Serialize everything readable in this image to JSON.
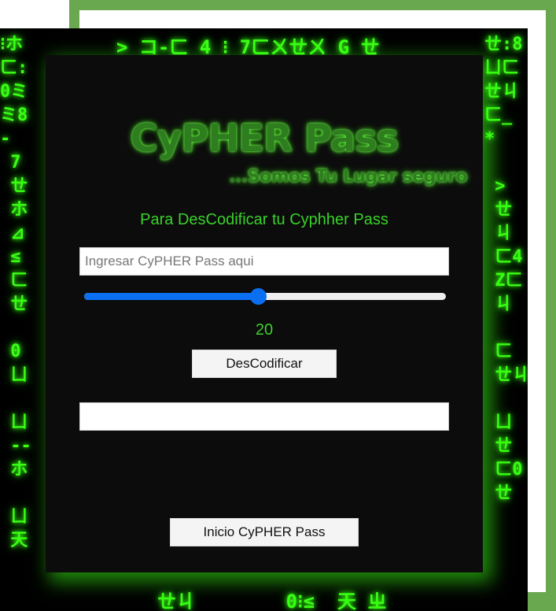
{
  "background": {
    "glyph_columns_left": [
      "⁝ホ",
      "ㄈ:",
      "0ミ",
      "ミ8",
      "-",
      " 7",
      " ㄝ",
      " ホ",
      " ⊿",
      " ≤",
      " ㄈ",
      " ㄝ",
      "",
      " 0",
      " ㄩ",
      "",
      " ㄩ",
      " --",
      " ホ",
      "",
      " ㄩ",
      " 天"
    ],
    "glyph_columns_right": [
      "ㄝ:8",
      "ㄩㄈ",
      "ㄝㄐ",
      "ㄈ_",
      "*",
      " ",
      " >",
      " ㄝ",
      " ㄐ",
      " ㄈ4",
      " Zㄈ",
      " ㄐ",
      " ",
      " ㄈ",
      " ㄝㄐ",
      " ",
      " ㄩ",
      " ㄝ",
      " ㄈ0",
      " ㄝ",
      " ",
      " "
    ],
    "top_row": "> コ-ㄈ 4 ⁝ 7ㄈㄨㄝㄨ G ㄝ",
    "bottom_row": "ㄝㄐ        0⁝≤  天 ㄓ",
    "accent_color": "#39ff14"
  },
  "header": {
    "title": "CyPHER Pass",
    "tagline": "...Somos Tu Lugar seguro",
    "subtitle": "Para DesCodificar tu Cyphher Pass"
  },
  "form": {
    "pass_placeholder": "Ingresar CyPHER Pass aqui",
    "pass_value": "",
    "slider_value": "20",
    "slider_fraction": 0.48,
    "decode_label": "DesCodificar",
    "result_value": "",
    "home_label": "Inicio CyPHER Pass"
  },
  "colors": {
    "frame_green": "#6aa84f",
    "slider_blue": "#0b6ff2",
    "text_green": "#39d12a"
  }
}
